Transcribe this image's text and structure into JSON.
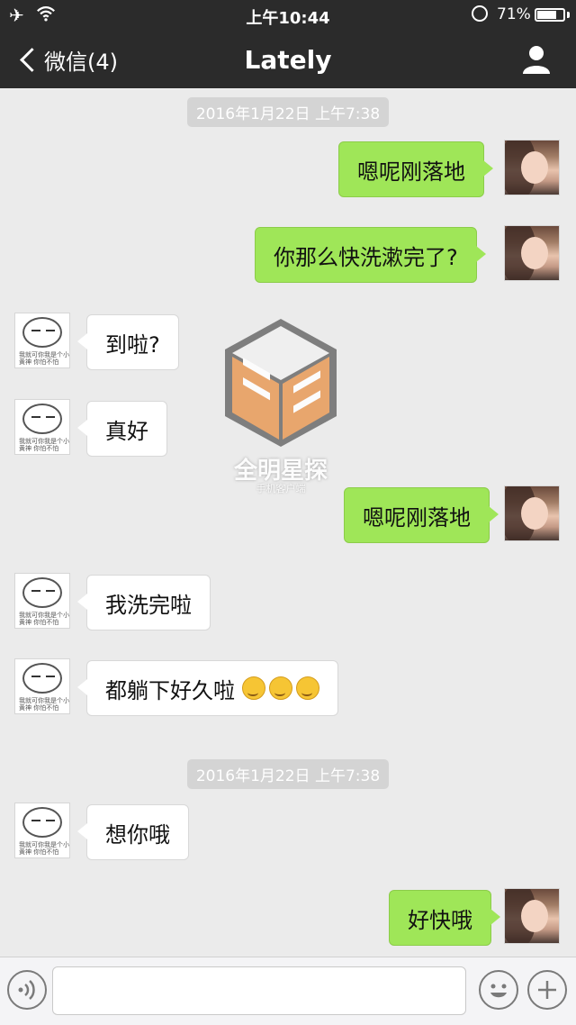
{
  "status": {
    "time": "上午10:44",
    "battery": "71%",
    "battery_level": 0.71,
    "icons": [
      "airplane-icon",
      "wifi-icon",
      "rotation-lock-icon",
      "battery-icon"
    ]
  },
  "nav": {
    "back_label": "微信(4)",
    "title": "Lately",
    "right_icon": "user-icon"
  },
  "timestamps": [
    "2016年1月22日 上午7:38",
    "2016年1月22日 上午7:38"
  ],
  "messages": [
    {
      "from": "me",
      "text": "嗯呢刚落地"
    },
    {
      "from": "me",
      "text": "你那么快洗漱完了?"
    },
    {
      "from": "them",
      "text": "到啦?"
    },
    {
      "from": "them",
      "text": "真好"
    },
    {
      "from": "me",
      "text": "嗯呢刚落地"
    },
    {
      "from": "them",
      "text": "我洗完啦"
    },
    {
      "from": "them",
      "text": "都躺下好久啦",
      "emoji": [
        "thinking-emoji",
        "thinking-emoji",
        "thinking-emoji"
      ]
    },
    {
      "from": "them",
      "text": "想你哦"
    },
    {
      "from": "me",
      "text": "好快哦"
    }
  ],
  "avatar_caption": "我就可你我是个小黄神 你怕不怕",
  "watermark": {
    "title": "全明星探",
    "subtitle": "手机客户端"
  },
  "input": {
    "placeholder": "",
    "left_icon": "voice-icon",
    "right_icons": [
      "emoji-icon",
      "plus-icon"
    ]
  }
}
